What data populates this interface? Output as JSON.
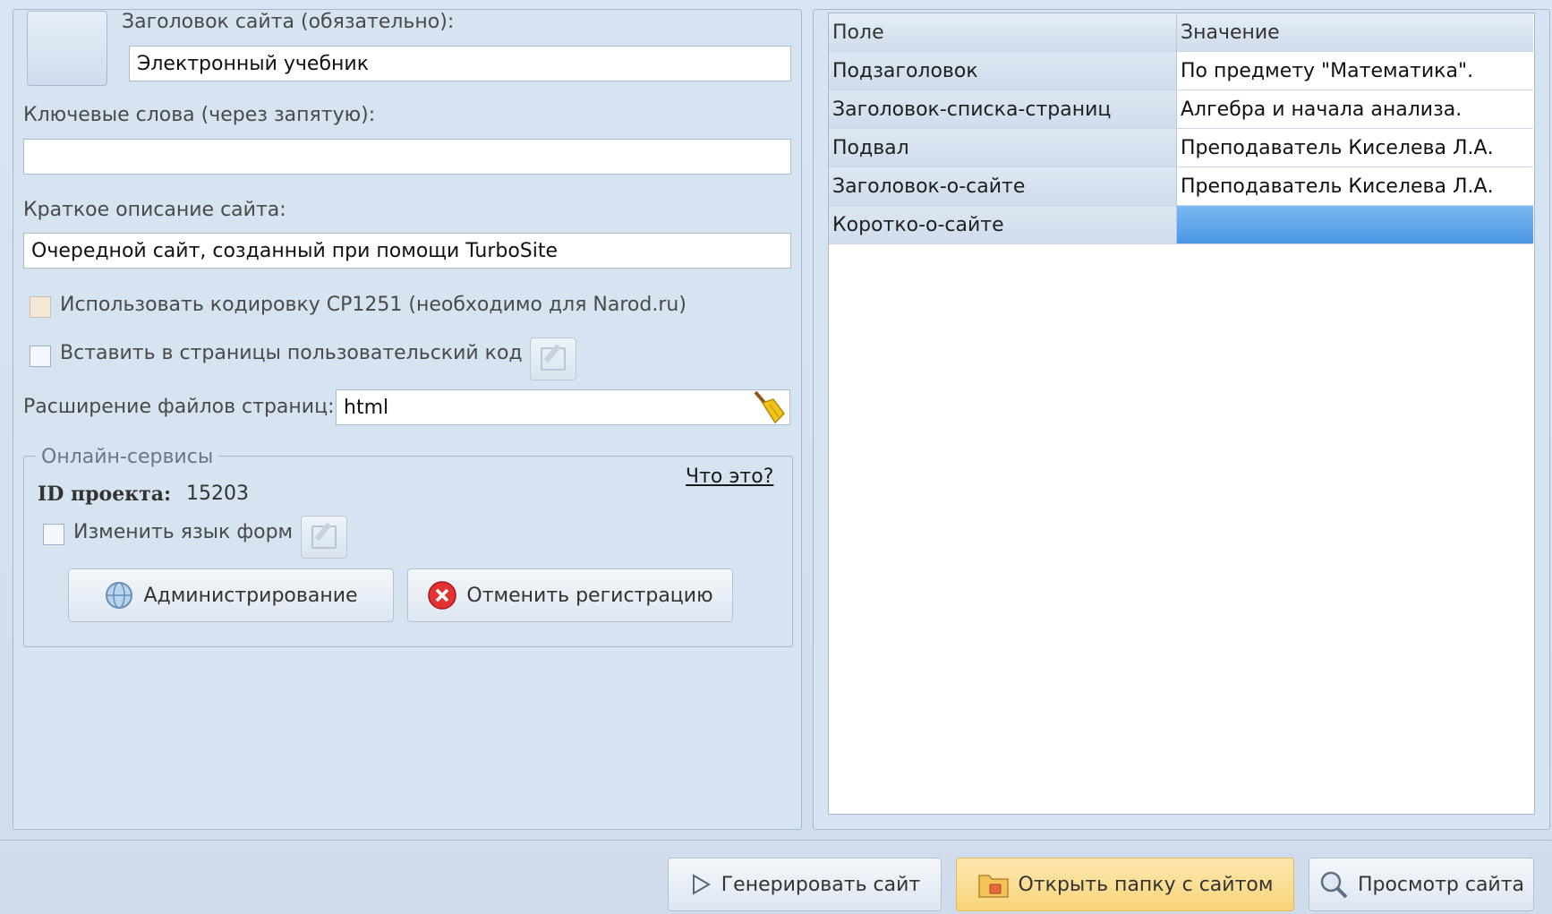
{
  "left": {
    "title_label": "Заголовок сайта (обязательно):",
    "title_value": "Электронный учебник",
    "keywords_label": "Ключевые слова (через запятую):",
    "keywords_value": "",
    "description_label": "Краткое описание сайта:",
    "description_value": "Очередной сайт, созданный при помощи TurboSite",
    "cp1251_label": "Использовать кодировку CP1251 (необходимо для Narod.ru)",
    "custom_code_label": "Вставить в страницы пользовательский код",
    "ext_label": "Расширение файлов страниц:",
    "ext_value": "html"
  },
  "online": {
    "legend": "Онлайн-сервисы",
    "what_link": "Что это?",
    "project_id_label": "ID проекта:",
    "project_id_value": "15203",
    "change_lang_label": "Изменить язык форм",
    "admin_button": "Администрирование",
    "cancel_reg_button": "Отменить регистрацию"
  },
  "grid": {
    "headers": [
      "Поле",
      "Значение"
    ],
    "rows": [
      {
        "field": "Подзаголовок",
        "value": "По предмету \"Математика\"."
      },
      {
        "field": "Заголовок-списка-страниц",
        "value": "Алгебра и начала анализа."
      },
      {
        "field": "Подвал",
        "value": "Преподаватель Киселева Л.А."
      },
      {
        "field": "Заголовок-о-сайте",
        "value": "Преподаватель Киселева Л.А."
      },
      {
        "field": "Коротко-о-сайте",
        "value": ""
      }
    ]
  },
  "footer": {
    "generate_button": "Генерировать сайт",
    "open_folder_button": "Открыть папку с сайтом",
    "preview_button": "Просмотр сайта"
  },
  "colors": {
    "panel_bg": "#d6e3f1",
    "selected_cell": "#4a97e6",
    "active_button": "#f8d47a"
  }
}
